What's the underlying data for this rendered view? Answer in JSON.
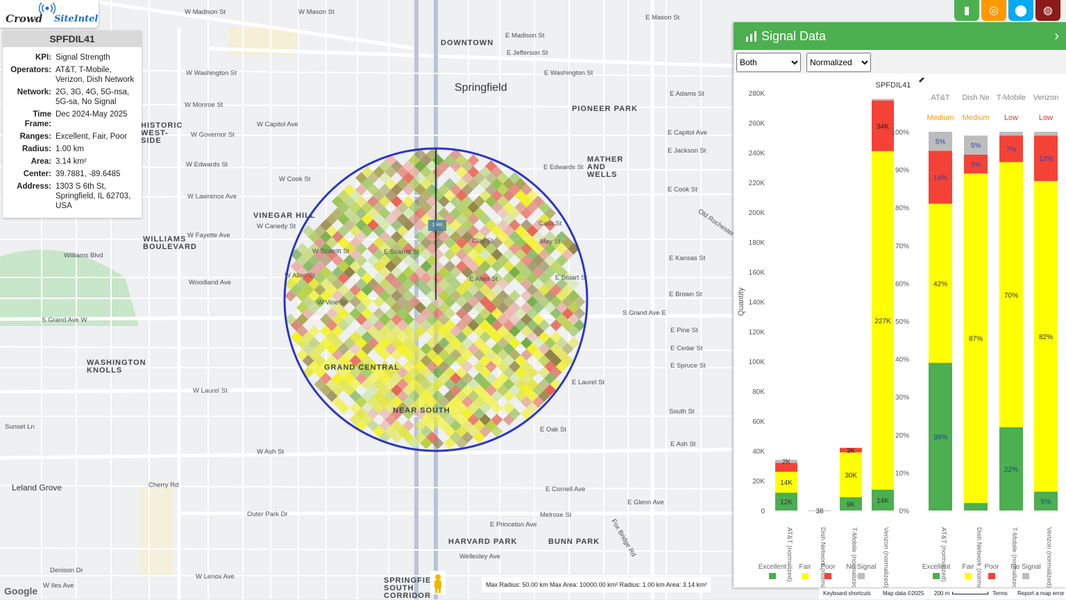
{
  "logo": {
    "part1": "Crowd",
    "part2": "SiteIntel"
  },
  "info": {
    "title": "SPFDIL41",
    "rows": [
      {
        "k": "KPI:",
        "v": "Signal Strength"
      },
      {
        "k": "Operators:",
        "v": "AT&T, T-Mobile, Verizon, Dish Network"
      },
      {
        "k": "Network:",
        "v": "2G, 3G, 4G, 5G-nsa, 5G-sa, No Signal"
      },
      {
        "k": "Time Frame:",
        "v": "Dec 2024-May 2025"
      },
      {
        "k": "Ranges:",
        "v": "Excellent, Fair, Poor"
      },
      {
        "k": "Radius:",
        "v": "1.00 km"
      },
      {
        "k": "Area:",
        "v": "3.14 km²"
      },
      {
        "k": "Center:",
        "v": "39.7881, -89.6485"
      },
      {
        "k": "Address:",
        "v": "1303 S 6th St, Springfield, IL 62703, USA"
      }
    ]
  },
  "top_buttons": [
    {
      "icon": "bar-chart-icon",
      "color": "#4caf50"
    },
    {
      "icon": "target-icon",
      "color": "#ff9800"
    },
    {
      "icon": "map-pin-icon",
      "color": "#03a9f4"
    },
    {
      "icon": "globe-icon",
      "color": "#8b1a1a"
    }
  ],
  "map": {
    "city": "Springfield",
    "downtown": "DOWNTOWN",
    "radius_label": "1 km",
    "areas": [
      "HISTORIC WEST-SIDE",
      "PIONEER PARK",
      "MATHER AND WELLS",
      "VINEGAR HILL",
      "WILLIAMS BOULEVARD",
      "WASHINGTON KNOLLS",
      "GRAND CENTRAL",
      "NEAR SOUTH",
      "HARVARD PARK",
      "BUNN PARK",
      "SPRINGFIELD SOUTH CORRIDOR",
      "Leland Grove"
    ],
    "streets": [
      "W Madison St",
      "W Mason St",
      "E Mason St",
      "E Madison St",
      "E Jefferson St",
      "W Washington St",
      "E Washington St",
      "W Monroe St",
      "E Adams St",
      "W Capitol Ave",
      "E Capitol Ave",
      "W Governor St",
      "W Edwards St",
      "E Edwards St",
      "E Jackson St",
      "W Cook St",
      "E Cook St",
      "W Lawrence Ave",
      "W Canedy St",
      "W Fayette Ave",
      "Williams Blvd",
      "W Scarritt St",
      "E Scarritt St",
      "Clay St",
      "Cass St",
      "May St",
      "E Kansas St",
      "W Allen St",
      "E Allen St",
      "E Stuart St",
      "Woodland Ave",
      "W Vine St",
      "E Brown St",
      "S Grand Ave W",
      "S Grand Ave E",
      "E Pine St",
      "E Cedar St",
      "E Spruce St",
      "E Laurel St",
      "W Laurel St",
      "South St",
      "E Oak St",
      "W Ash St",
      "E Ash St",
      "E Cornell Ave",
      "Outer Park Dr",
      "E Glenn Ave",
      "Melrose St",
      "E Princeton Ave",
      "Wellesley Ave",
      "W Lenox Ave",
      "W Iles Ave",
      "Sunset Ln",
      "Cherry Rd",
      "Denison Dr",
      "Old Rochester Rd",
      "Fox Bridge Rd"
    ],
    "scale_text": "Max Radius: 50.00 km Max Area: 10000.00 km² Radius: 1.00 km Area: 3.14 km²",
    "google": "Google",
    "attribution": [
      "Keyboard shortcuts",
      "Map data ©2025",
      "200 m",
      "Terms",
      "Report a map error"
    ]
  },
  "panel": {
    "title": "Signal Data",
    "mode_select": "Both",
    "norm_select": "Normalized",
    "colors": {
      "excellent": "#4caf50",
      "fair": "#ffff00",
      "poor": "#f44336",
      "nosignal": "#bdbdbd"
    }
  },
  "chart_data": [
    {
      "type": "bar",
      "title": "SPFDIL41",
      "ylabel": "Quantity",
      "ylim": [
        0,
        280000
      ],
      "categories": [
        "AT&T (normalized)",
        "Dish Network (normalized)",
        "T-Mobile (normalized)",
        "Verizon (normalized)"
      ],
      "series": [
        {
          "name": "Excellent",
          "values": [
            12000,
            0,
            9000,
            14000
          ],
          "labels": [
            "12K",
            "",
            "9K",
            "14K"
          ]
        },
        {
          "name": "Fair",
          "values": [
            14000,
            0,
            30000,
            227000
          ],
          "labels": [
            "14K",
            "",
            "30K",
            "227K"
          ]
        },
        {
          "name": "Poor",
          "values": [
            6000,
            0,
            3000,
            34000
          ],
          "labels": [
            "",
            "",
            "3K",
            "34K"
          ]
        },
        {
          "name": "No Signal",
          "values": [
            2000,
            38,
            0,
            1000
          ],
          "labels": [
            "2K",
            "38",
            "",
            ""
          ]
        }
      ],
      "yticks": [
        "0",
        "20K",
        "40K",
        "60K",
        "80K",
        "100K",
        "120K",
        "140K",
        "160K",
        "180K",
        "200K",
        "220K",
        "240K",
        "260K",
        "280K"
      ],
      "legend": [
        "Excellent",
        "Fair",
        "Poor",
        "No Signal"
      ]
    },
    {
      "type": "bar",
      "stacked_percent": true,
      "categories": [
        "AT&T (normalized)",
        "Dish Network (normalized)",
        "T-Mobile (normalized)",
        "Verizon (normalized)"
      ],
      "headers": [
        "AT&T",
        "Dish Ne",
        "T-Mobile",
        "Verizon"
      ],
      "ratings": [
        "Medium",
        "Medium",
        "Low",
        "Low"
      ],
      "series": [
        {
          "name": "Excellent",
          "values": [
            39,
            2,
            22,
            5
          ],
          "labels": [
            "39%",
            "",
            "22%",
            "5%"
          ]
        },
        {
          "name": "Fair",
          "values": [
            42,
            87,
            70,
            82
          ],
          "labels": [
            "42%",
            "87%",
            "70%",
            "82%"
          ]
        },
        {
          "name": "Poor",
          "values": [
            14,
            5,
            7,
            12
          ],
          "labels": [
            "14%",
            "5%",
            "7%",
            "12%"
          ]
        },
        {
          "name": "No Signal",
          "values": [
            5,
            5,
            1,
            1
          ],
          "labels": [
            "5%",
            "5%",
            "",
            ""
          ]
        }
      ],
      "yticks": [
        "0%",
        "10%",
        "20%",
        "30%",
        "40%",
        "50%",
        "60%",
        "70%",
        "80%",
        "90%",
        "100%"
      ],
      "legend": [
        "Excellent",
        "Fair",
        "Poor",
        "No Signal"
      ]
    }
  ]
}
